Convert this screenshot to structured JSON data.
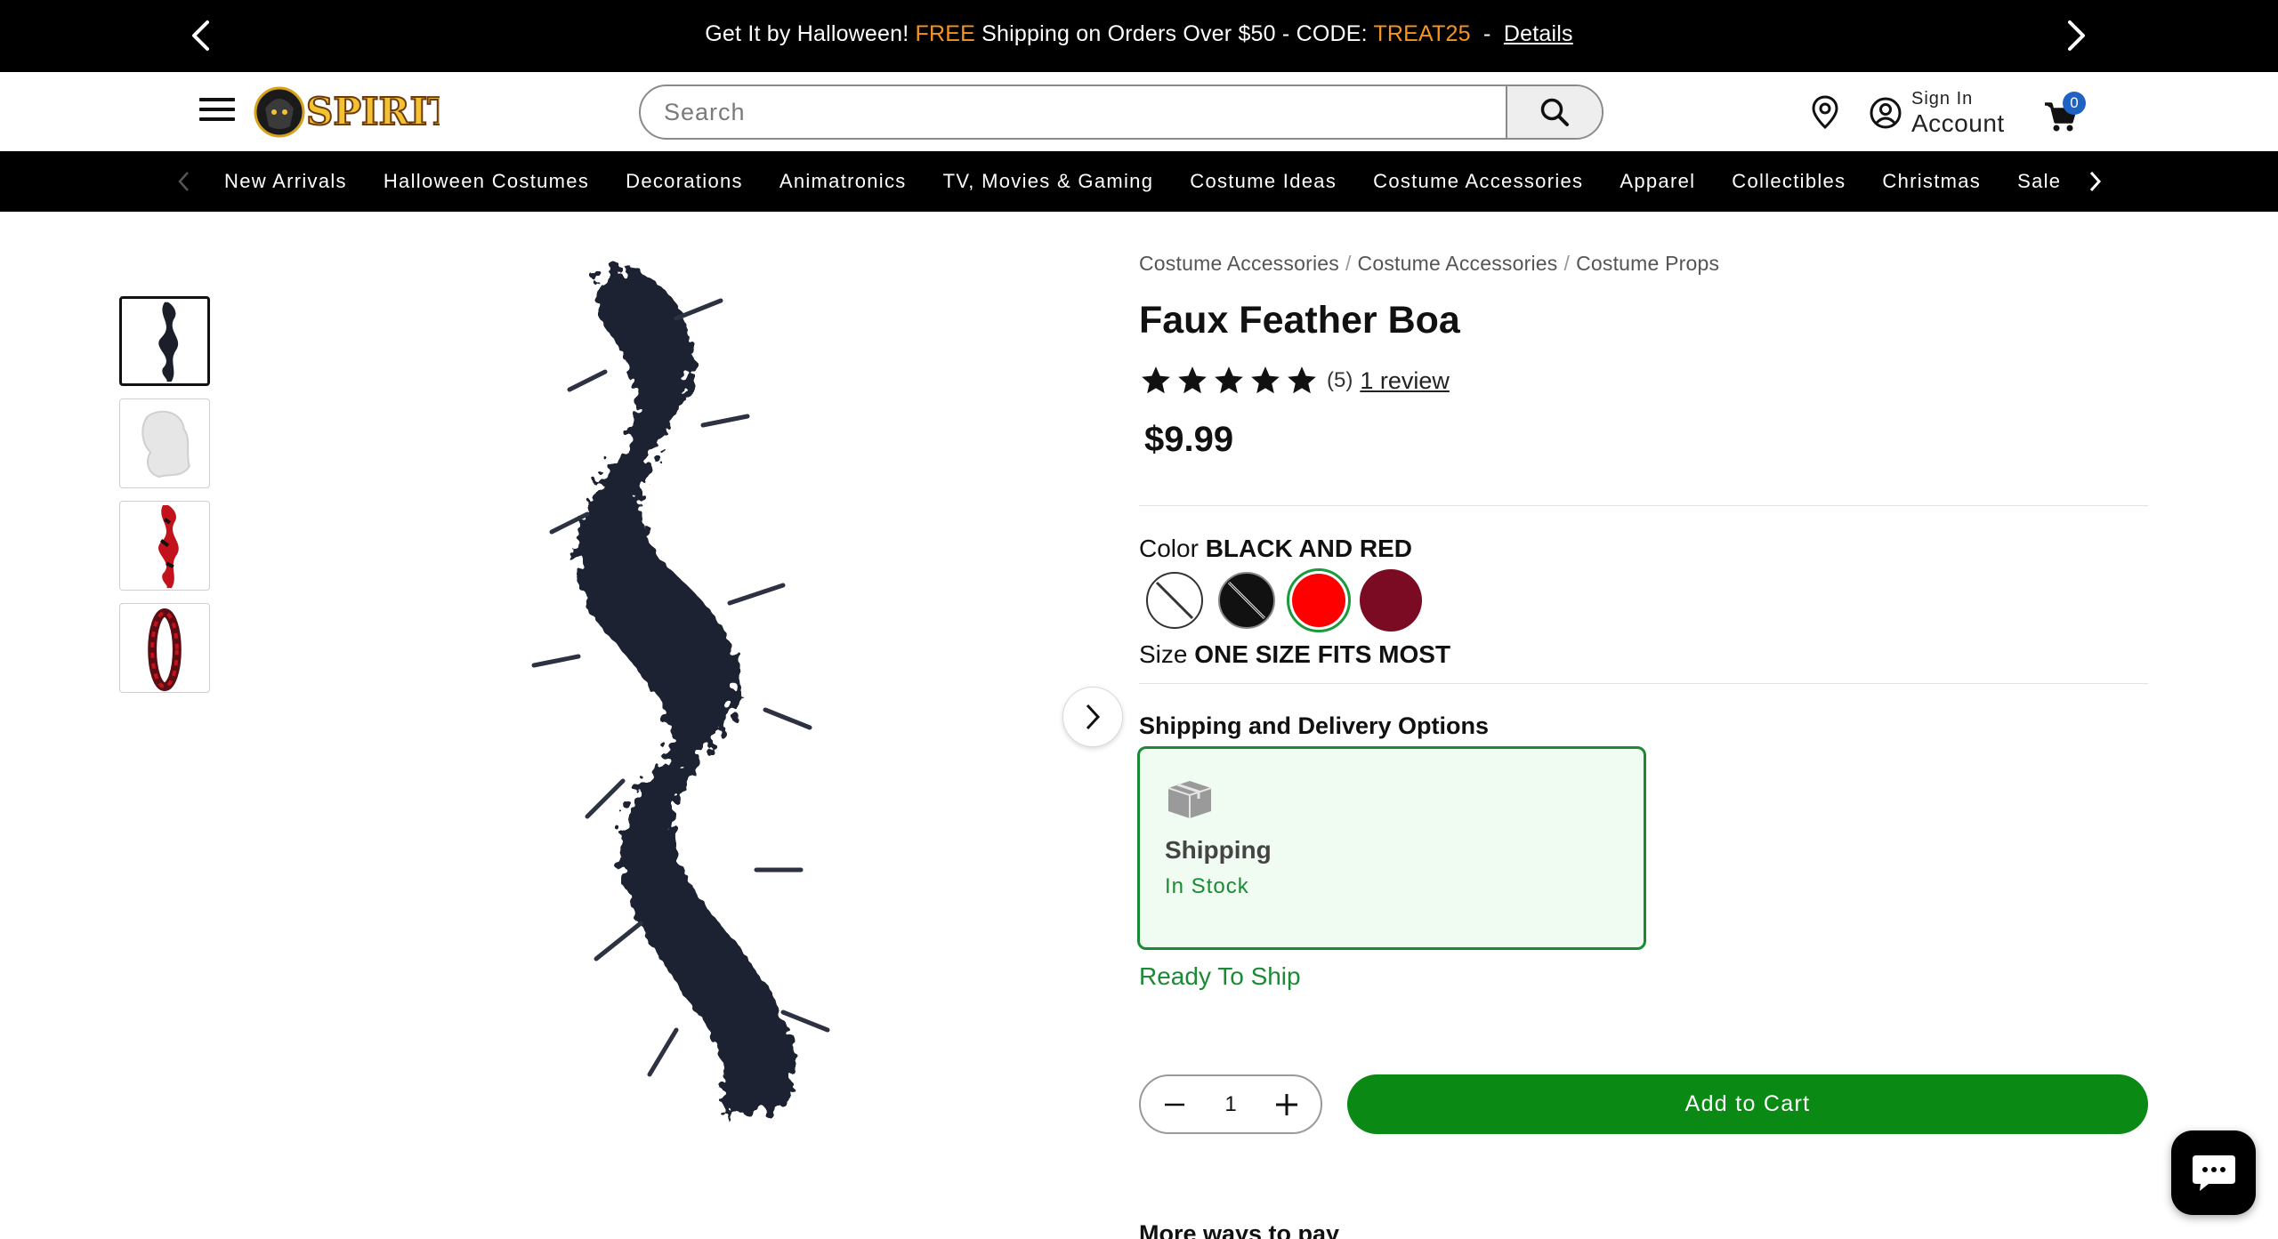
{
  "promo": {
    "part1": "Get It by Halloween! ",
    "free": "FREE",
    "part2": " Shipping on Orders Over $50 - CODE: ",
    "code": "TREAT25",
    "part3": "  -  ",
    "details_link": "Details",
    "highlight_color": "#f7941d"
  },
  "header": {
    "logo_text": "SPIRIT",
    "search_placeholder": "Search",
    "account": {
      "sign_in": "Sign In",
      "label": "Account"
    },
    "cart_count": "0"
  },
  "category_nav": {
    "items": [
      "New Arrivals",
      "Halloween Costumes",
      "Decorations",
      "Animatronics",
      "TV, Movies & Gaming",
      "Costume Ideas",
      "Costume Accessories",
      "Apparel",
      "Collectibles",
      "Christmas",
      "Sale"
    ]
  },
  "product": {
    "breadcrumbs": [
      "Costume Accessories",
      "Costume Accessories",
      "Costume Props"
    ],
    "breadcrumb_separator": "/",
    "title": "Faux Feather Boa",
    "rating": {
      "stars": 5,
      "count_text": "(5)",
      "reviews_link": "1 review"
    },
    "price": "$9.99",
    "color": {
      "label": "Color",
      "selected": "BLACK AND RED",
      "swatches": [
        {
          "name": "white",
          "color": "#ffffff",
          "unavailable": true
        },
        {
          "name": "black",
          "color": "#111111",
          "unavailable": true
        },
        {
          "name": "black and red",
          "color": "#ff0000",
          "selected": true
        },
        {
          "name": "burgundy",
          "color": "#7a0b22"
        }
      ]
    },
    "size": {
      "label": "Size",
      "selected": "ONE SIZE FITS MOST"
    },
    "shipping": {
      "heading": "Shipping and Delivery Options",
      "option_title": "Shipping",
      "option_status": "In Stock",
      "ready_text": "Ready To Ship"
    },
    "quantity": "1",
    "add_to_cart": "Add to Cart",
    "more_ways_to_pay": "More ways to pay"
  },
  "colors": {
    "accent_green": "#0a8a14",
    "status_green": "#1a8a34",
    "cart_badge": "#1e63c4"
  }
}
